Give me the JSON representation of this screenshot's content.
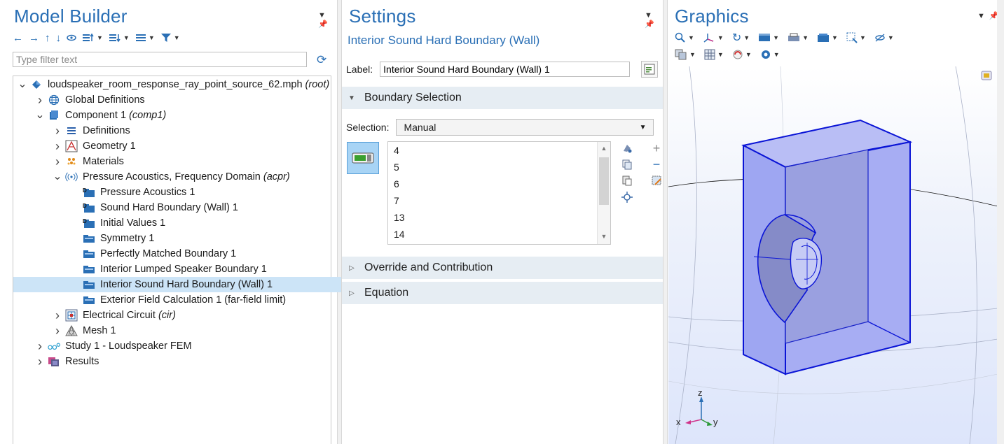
{
  "model_builder": {
    "title": "Model Builder",
    "filter_placeholder": "Type filter text",
    "tree": [
      {
        "label": "loudspeaker_room_response_ray_point_source_62.mph",
        "suffix": "(root)",
        "level": 0,
        "expand": "down",
        "icon": "mph-file-icon"
      },
      {
        "label": "Global Definitions",
        "suffix": "",
        "level": 1,
        "expand": "right",
        "icon": "globe-icon"
      },
      {
        "label": "Component 1",
        "suffix": "(comp1)",
        "level": 1,
        "expand": "down",
        "icon": "component-icon"
      },
      {
        "label": "Definitions",
        "suffix": "",
        "level": 2,
        "expand": "right",
        "icon": "definitions-icon"
      },
      {
        "label": "Geometry 1",
        "suffix": "",
        "level": 2,
        "expand": "right",
        "icon": "geometry-icon"
      },
      {
        "label": "Materials",
        "suffix": "",
        "level": 2,
        "expand": "right",
        "icon": "materials-icon"
      },
      {
        "label": "Pressure Acoustics, Frequency Domain",
        "suffix": "(acpr)",
        "level": 2,
        "expand": "down",
        "icon": "acoustics-icon"
      },
      {
        "label": "Pressure Acoustics 1",
        "suffix": "",
        "level": 3,
        "expand": "",
        "icon": "default-feature-icon"
      },
      {
        "label": "Sound Hard Boundary (Wall) 1",
        "suffix": "",
        "level": 3,
        "expand": "",
        "icon": "default-feature-icon"
      },
      {
        "label": "Initial Values 1",
        "suffix": "",
        "level": 3,
        "expand": "",
        "icon": "default-feature-icon"
      },
      {
        "label": "Symmetry 1",
        "suffix": "",
        "level": 3,
        "expand": "",
        "icon": "boundary-feature-icon"
      },
      {
        "label": "Perfectly Matched Boundary 1",
        "suffix": "",
        "level": 3,
        "expand": "",
        "icon": "boundary-feature-icon"
      },
      {
        "label": "Interior Lumped Speaker Boundary 1",
        "suffix": "",
        "level": 3,
        "expand": "",
        "icon": "boundary-feature-icon"
      },
      {
        "label": "Interior Sound Hard Boundary (Wall) 1",
        "suffix": "",
        "level": 3,
        "expand": "",
        "icon": "boundary-feature-icon",
        "selected": true
      },
      {
        "label": "Exterior Field Calculation 1 (far-field limit)",
        "suffix": "",
        "level": 3,
        "expand": "",
        "icon": "boundary-feature-icon"
      },
      {
        "label": "Electrical Circuit",
        "suffix": "(cir)",
        "level": 2,
        "expand": "right",
        "icon": "circuit-icon"
      },
      {
        "label": "Mesh 1",
        "suffix": "",
        "level": 2,
        "expand": "right",
        "icon": "mesh-icon"
      },
      {
        "label": "Study 1 - Loudspeaker FEM",
        "suffix": "",
        "level": 1,
        "expand": "right",
        "icon": "study-icon"
      },
      {
        "label": "Results",
        "suffix": "",
        "level": 1,
        "expand": "right",
        "icon": "results-icon"
      }
    ]
  },
  "settings": {
    "title": "Settings",
    "subtitle": "Interior Sound Hard Boundary (Wall)",
    "label_caption": "Label:",
    "label_value": "Interior Sound Hard Boundary (Wall) 1",
    "sections": {
      "boundary_selection": "Boundary Selection",
      "override": "Override and Contribution",
      "equation": "Equation"
    },
    "selection_caption": "Selection:",
    "selection_value": "Manual",
    "boundaries": [
      "4",
      "5",
      "6",
      "7",
      "13",
      "14"
    ]
  },
  "graphics": {
    "title": "Graphics",
    "axes": {
      "z": "z",
      "x": "x",
      "y": "y"
    }
  },
  "colors": {
    "accent": "#2a6fb5",
    "selection_bg": "#cce4f7",
    "section_bg": "#e6edf3",
    "body_fill": "#9ea6f2",
    "body_edge": "#0a14d6"
  }
}
